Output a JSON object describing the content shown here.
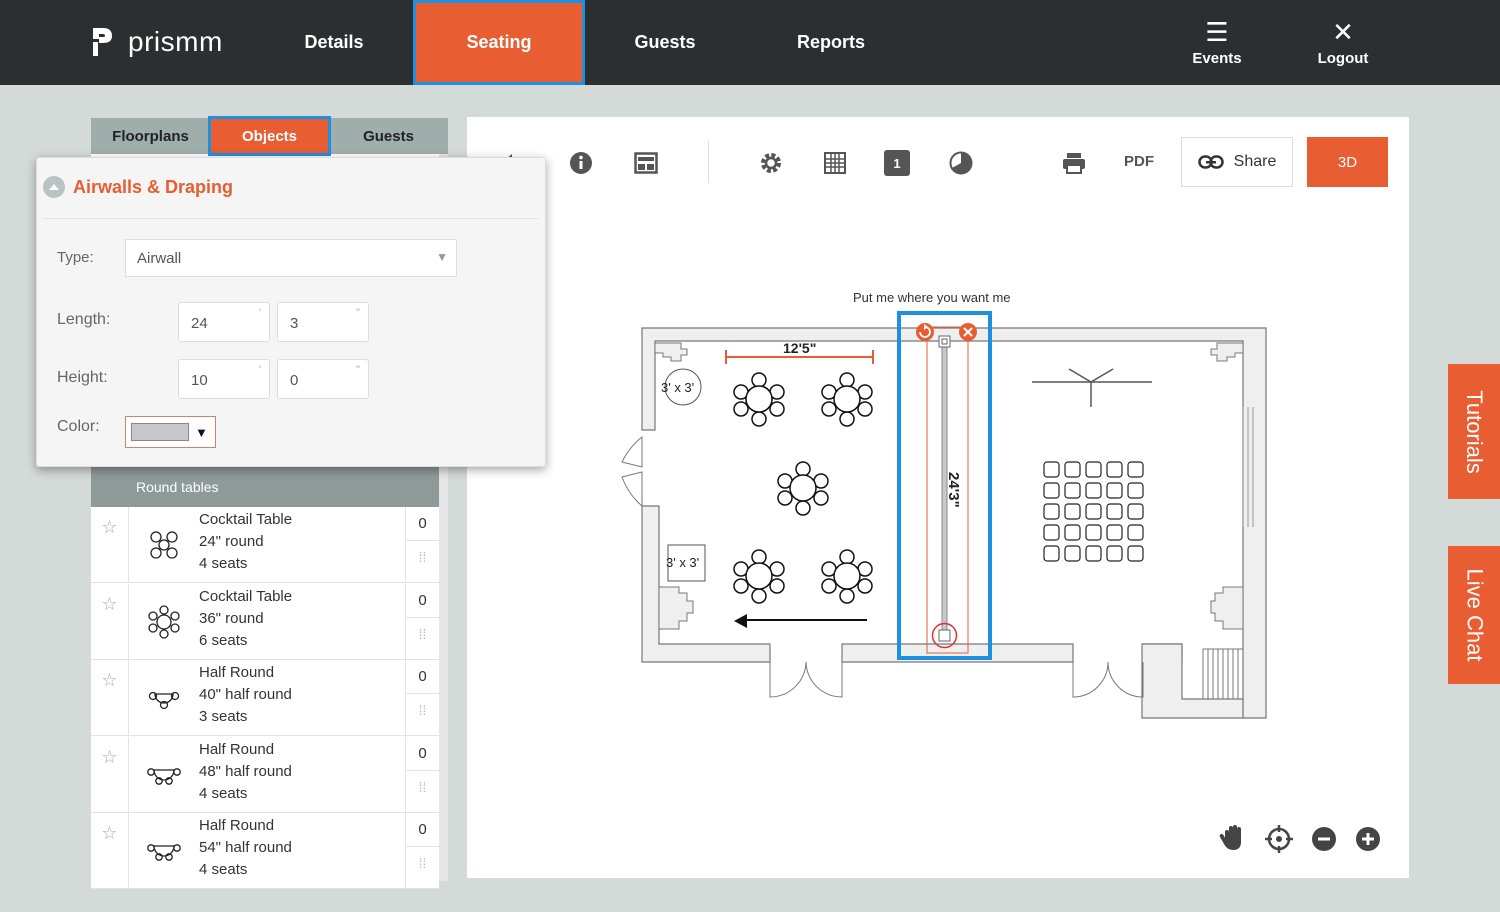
{
  "app": {
    "logo_text": "prismm"
  },
  "nav": {
    "items": [
      {
        "label": "Details"
      },
      {
        "label": "Seating"
      },
      {
        "label": "Guests"
      },
      {
        "label": "Reports"
      }
    ],
    "events_label": "Events",
    "logout_label": "Logout"
  },
  "left_panel": {
    "tabs": [
      {
        "label": "Floorplans"
      },
      {
        "label": "Objects"
      },
      {
        "label": "Guests"
      }
    ],
    "section_header": "Round tables",
    "items": [
      {
        "name": "Cocktail Table",
        "size": "24\" round",
        "seats": "4 seats",
        "qty": "0",
        "icon": "round-4-icon"
      },
      {
        "name": "Cocktail Table",
        "size": "36\" round",
        "seats": "6 seats",
        "qty": "0",
        "icon": "round-6-icon"
      },
      {
        "name": "Half Round",
        "size": "40\" half round",
        "seats": "3 seats",
        "qty": "0",
        "icon": "half-round-3-icon"
      },
      {
        "name": "Half Round",
        "size": "48\" half round",
        "seats": "4 seats",
        "qty": "0",
        "icon": "half-round-4-icon"
      },
      {
        "name": "Half Round",
        "size": "54\" half round",
        "seats": "4 seats",
        "qty": "0",
        "icon": "half-round-4-icon"
      }
    ]
  },
  "popup": {
    "title": "Airwalls & Draping",
    "type_label": "Type:",
    "type_value": "Airwall",
    "length_label": "Length:",
    "length_ft": "24",
    "length_in": "3",
    "height_label": "Height:",
    "height_ft": "10",
    "height_in": "0",
    "color_label": "Color:",
    "color_value": "#c8c8c8",
    "unit_ft": "'",
    "unit_in": "\""
  },
  "toolbar": {
    "pdf_label": "PDF",
    "share_label": "Share",
    "three_d_label": "3D",
    "page_number": "1"
  },
  "canvas": {
    "hint": "Put me where you want me",
    "dimension_top": "12'5\"",
    "airwall_length": "24'3\"",
    "small_table_1": "3' x 3'",
    "small_table_2": "3' x 3'"
  },
  "side_tabs": {
    "tutorials": "Tutorials",
    "live_chat": "Live Chat"
  },
  "colors": {
    "accent": "#e85d32",
    "dark": "#2c2e32",
    "highlight": "#1e90e0"
  }
}
